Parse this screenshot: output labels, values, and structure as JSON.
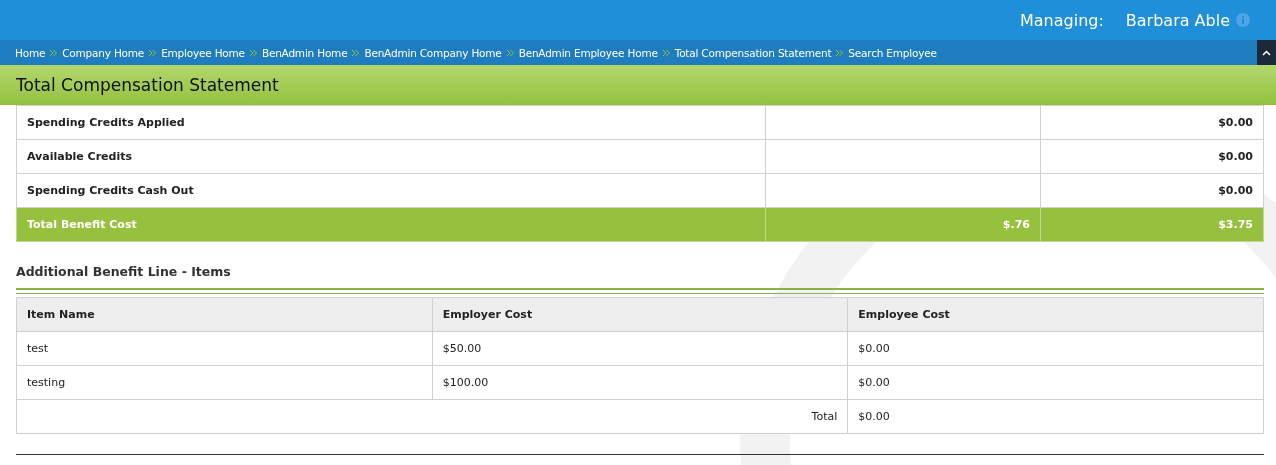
{
  "header": {
    "managing_label": "Managing:",
    "managed_name": "Barbara Able"
  },
  "breadcrumbs": [
    "Home",
    "Company Home",
    "Employee Home",
    "BenAdmin Home",
    "BenAdmin Company Home",
    "BenAdmin Employee Home",
    "Total Compensation Statement",
    "Search Employee"
  ],
  "page_title": "Total Compensation Statement",
  "summary_rows": [
    {
      "label": "Spending Credits Applied",
      "column_2": "",
      "column_3": "$0.00",
      "kind": "normal"
    },
    {
      "label": "Available Credits",
      "column_2": "",
      "column_3": "$0.00",
      "kind": "normal"
    },
    {
      "label": "Spending Credits Cash Out",
      "column_2": "",
      "column_3": "$0.00",
      "kind": "normal"
    },
    {
      "label": "Total Benefit Cost",
      "column_2": "$.76",
      "column_3": "$3.75",
      "kind": "total"
    }
  ],
  "section_title": "Additional Benefit Line - Items",
  "items_table": {
    "columns": [
      "Item Name",
      "Employer Cost",
      "Employee Cost"
    ],
    "rows": [
      {
        "item_name": "test",
        "employer_cost": "$50.00",
        "employee_cost": "$0.00"
      },
      {
        "item_name": "testing",
        "employer_cost": "$100.00",
        "employee_cost": "$0.00"
      }
    ],
    "total_label": "Total",
    "total_value": "$0.00"
  }
}
